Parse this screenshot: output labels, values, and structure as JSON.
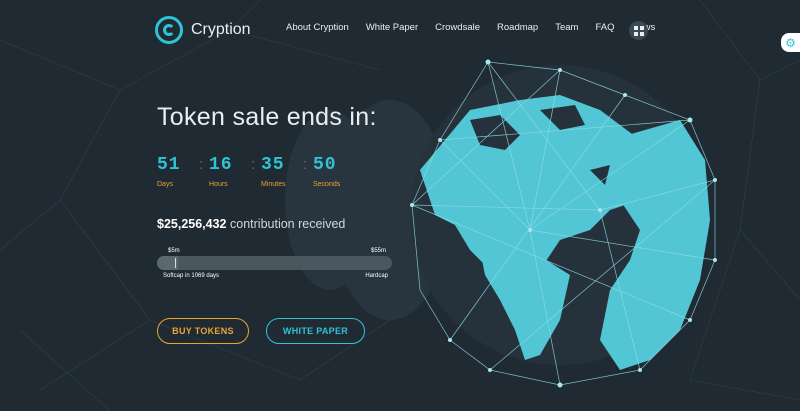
{
  "brand": {
    "name": "Cryption"
  },
  "nav": {
    "items": [
      "About Cryption",
      "White Paper",
      "Crowdsale",
      "Roadmap",
      "Team",
      "FAQ",
      "News"
    ]
  },
  "hero": {
    "headline": "Token sale ends in:",
    "countdown": [
      {
        "value": "51",
        "label": "Days"
      },
      {
        "value": "16",
        "label": "Hours"
      },
      {
        "value": "35",
        "label": "Minutes"
      },
      {
        "value": "50",
        "label": "Seconds"
      }
    ],
    "contribution": {
      "amount": "$25,256,432",
      "text": "contribution received"
    },
    "progress": {
      "softcap_value": "$5m",
      "hardcap_value": "$55m",
      "softcap_note": "Softcap in 1069 days",
      "hardcap_label": "Hardcap",
      "fill_fraction": 0.09
    },
    "buttons": {
      "buy": "BUY TOKENS",
      "white_paper": "WHITE PAPER"
    }
  },
  "colors": {
    "accent": "#2fc3d6",
    "highlight": "#e8a534",
    "background": "#1f2a33",
    "globe_land": "#52c6d4"
  },
  "icons": {
    "logo": "cryption-logo-icon",
    "menu": "grid-menu-icon",
    "settings": "gear-icon"
  }
}
